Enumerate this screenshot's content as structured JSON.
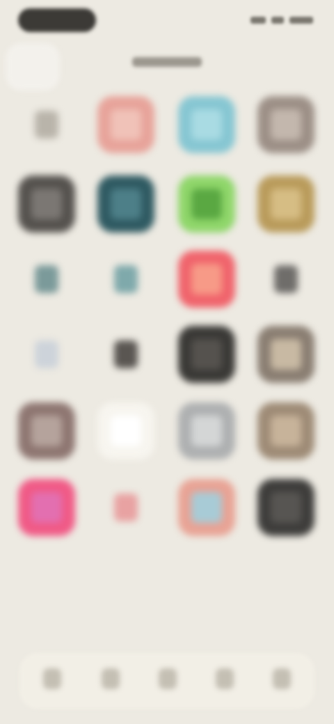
{
  "colors": {
    "background": "#edeae2",
    "dock": "#f2efe6",
    "status_pill": "#3c3a36"
  },
  "status_bar": {
    "icons": [
      "signal-icon",
      "wifi-icon",
      "battery-icon"
    ]
  },
  "page_title": "",
  "apps": [
    {
      "name": "app-icon-r1c1",
      "color": "transparent",
      "glyph": "#b9b4aa"
    },
    {
      "name": "app-icon-r1c2",
      "color": "#e7a39a",
      "glyph": "#f0c2b8"
    },
    {
      "name": "app-icon-r1c3",
      "color": "#86c6d2",
      "glyph": "#a9dbe3"
    },
    {
      "name": "app-icon-r1c4",
      "color": "#9c8f86",
      "glyph": "#c3b7ad"
    },
    {
      "name": "app-icon-r2c1",
      "color": "#55524e",
      "glyph": "#7b7773"
    },
    {
      "name": "app-icon-r2c2",
      "color": "#2f5a62",
      "glyph": "#4d7f88"
    },
    {
      "name": "app-icon-r2c3",
      "color": "#8fd66a",
      "glyph": "#5aa842"
    },
    {
      "name": "app-icon-r2c4",
      "color": "#b99b5b",
      "glyph": "#d6bd84"
    },
    {
      "name": "app-icon-r3c1",
      "color": "transparent",
      "glyph": "#7b9a9a"
    },
    {
      "name": "app-icon-r3c2",
      "color": "transparent",
      "glyph": "#7fa9ab"
    },
    {
      "name": "app-icon-r3c3",
      "color": "#f0646c",
      "glyph": "#f79a87"
    },
    {
      "name": "app-icon-r3c4",
      "color": "transparent",
      "glyph": "#6f6d6a"
    },
    {
      "name": "app-icon-r4c1",
      "color": "transparent",
      "glyph": "#cdd3da"
    },
    {
      "name": "app-icon-r4c2",
      "color": "transparent",
      "glyph": "#5a5652"
    },
    {
      "name": "app-icon-r4c3",
      "color": "#3a3936",
      "glyph": "#55524e"
    },
    {
      "name": "app-icon-r4c4",
      "color": "#8a7e72",
      "glyph": "#c8b9a3"
    },
    {
      "name": "app-icon-r5c1",
      "color": "#8e7671",
      "glyph": "#b5a39c"
    },
    {
      "name": "app-icon-r5c2",
      "color": "#f7f5ef",
      "glyph": "#ffffff"
    },
    {
      "name": "app-icon-r5c3",
      "color": "#aeb0b1",
      "glyph": "#d4d6d6"
    },
    {
      "name": "app-icon-r5c4",
      "color": "#9e8b76",
      "glyph": "#c7b39a"
    },
    {
      "name": "app-icon-r6c1",
      "color": "#f05a86",
      "glyph": "#e36fb0"
    },
    {
      "name": "app-icon-r6c2",
      "color": "transparent",
      "glyph": "#e8a2a2"
    },
    {
      "name": "app-icon-r6c3",
      "color": "#e8a395",
      "glyph": "#a8cbd6"
    },
    {
      "name": "app-icon-r6c4",
      "color": "#3e3d3b",
      "glyph": "#575552"
    }
  ],
  "dock": {
    "items": [
      "dock-icon-1",
      "dock-icon-2",
      "dock-icon-3",
      "dock-icon-4",
      "dock-icon-5"
    ]
  }
}
